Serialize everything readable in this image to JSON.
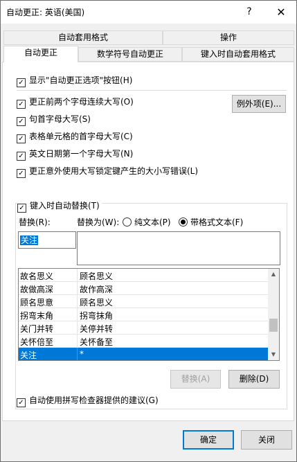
{
  "window": {
    "title": "自动更正: 英语(美国)",
    "help_label": "?",
    "close_label": "✕"
  },
  "tabs_top": [
    "自动套用格式",
    "操作"
  ],
  "tabs_bottom": [
    "自动更正",
    "数学符号自动更正",
    "键入时自动套用格式"
  ],
  "checkboxes": {
    "show_buttons": "显示\"自动更正选项\"按钮(H)",
    "two_caps": "更正前两个字母连续大写(O)",
    "sentence_cap": "句首字母大写(S)",
    "table_cell_cap": "表格单元格的首字母大写(C)",
    "day_names": "英文日期第一个字母大写(N)",
    "caps_lock": "更正意外使用大写锁定键产生的大小写错误(L)",
    "replace_as_type": "键入时自动替换(T)",
    "spell_suggest": "自动使用拼写检查器提供的建议(G)"
  },
  "buttons": {
    "exceptions": "例外项(E)...",
    "replace": "替换(A)",
    "delete": "删除(D)",
    "ok": "确定",
    "close": "关闭"
  },
  "replace_section": {
    "replace_label": "替换(R):",
    "with_label": "替换为(W):",
    "plain_text": "纯文本(P)",
    "formatted_text": "带格式文本(F)",
    "replace_value": "关注",
    "with_value": ""
  },
  "entries": [
    {
      "from": "故名思义",
      "to": "顾名思义"
    },
    {
      "from": "故做高深",
      "to": "故作高深"
    },
    {
      "from": "顾名思意",
      "to": "顾名思义"
    },
    {
      "from": "拐弯末角",
      "to": "拐弯抹角"
    },
    {
      "from": "关门并转",
      "to": "关停并转"
    },
    {
      "from": "关怀倍至",
      "to": "关怀备至"
    },
    {
      "from": "关注",
      "to": "*"
    }
  ]
}
